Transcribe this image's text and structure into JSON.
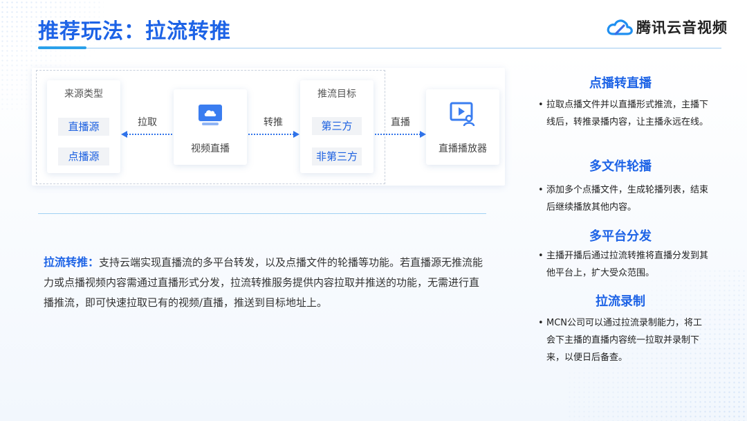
{
  "page": {
    "title": "推荐玩法：拉流转推",
    "brand": "腾讯云音视频",
    "accent": "#1d63e6"
  },
  "diagram": {
    "source": {
      "head": "来源类型",
      "items": [
        "直播源",
        "点播源"
      ]
    },
    "pull_label": "拉取",
    "center": {
      "icon": "cloud-monitor-icon",
      "label": "视频直播"
    },
    "push_label": "转推",
    "target": {
      "head": "推流目标",
      "items": [
        "第三方",
        "非第三方"
      ]
    },
    "live_label": "直播",
    "player": {
      "icon": "video-player-icon",
      "label": "直播播放器"
    }
  },
  "description": {
    "lead": "拉流转推：",
    "text": "支持云端实现直播流的多平台转发，以及点播文件的轮播等功能。若直播源无推流能力或点播视频内容需通过直播形式分发，拉流转推服务提供内容拉取并推送的功能，无需进行直播推流，即可快速拉取已有的视频/直播，推送到目标地址上。"
  },
  "features": [
    {
      "title": "点播转直播",
      "bullet": "•",
      "text": "拉取点播文件并以直播形式推流，主播下线后，转推录播内容，让主播永远在线。"
    },
    {
      "title": "多文件轮播",
      "bullet": "•",
      "text": "添加多个点播文件，生成轮播列表，结束后继续播放其他内容。"
    },
    {
      "title": "多平台分发",
      "bullet": "•",
      "text": "主播开播后通过拉流转推将直播分发到其他平台上，扩大受众范围。"
    },
    {
      "title": "拉流录制",
      "bullet": "•",
      "text": "MCN公司可以通过拉流录制能力，将工会下主播的直播内容统一拉取并录制下来，以便日后备查。"
    }
  ]
}
